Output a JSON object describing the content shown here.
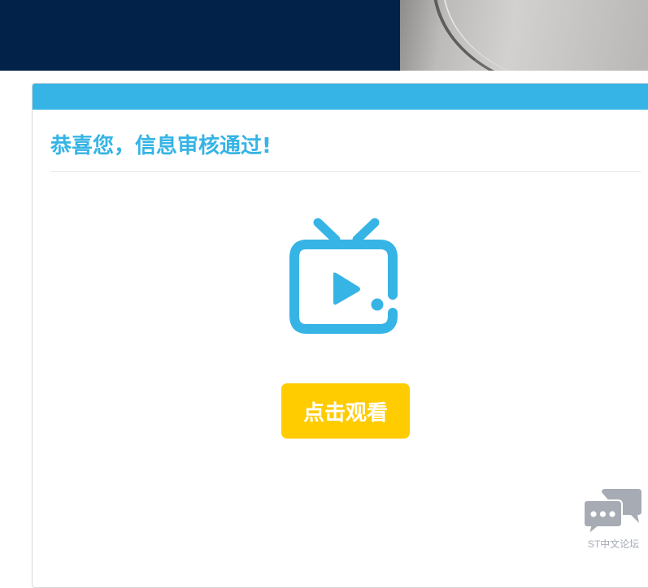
{
  "banner": {
    "background_color": "#03224a"
  },
  "card": {
    "header_color": "#36b4e5",
    "title": "恭喜您，信息审核通过!",
    "icon": "tv-play-icon",
    "watch_button_label": "点击观看",
    "accent_color": "#36b4e5",
    "button_color": "#ffcc00"
  },
  "floating_widget": {
    "icon": "chat-bubbles-icon",
    "label": "ST中文论坛"
  }
}
